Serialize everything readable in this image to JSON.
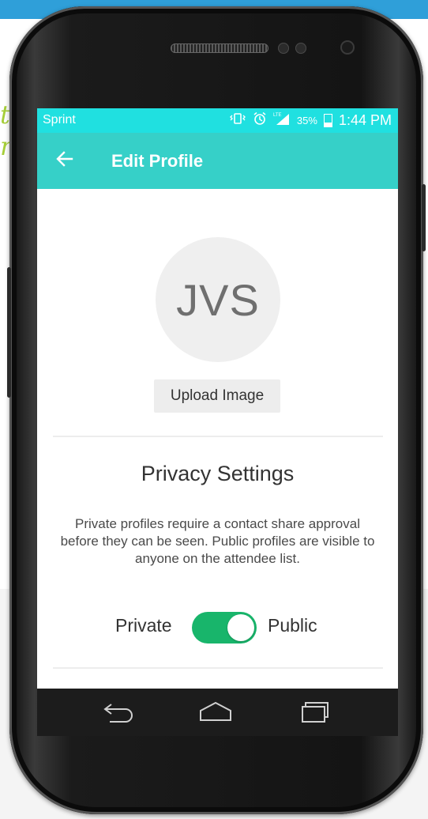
{
  "colors": {
    "status_bar": "#20e0e0",
    "app_bar": "#36d0c8",
    "toggle_on": "#18b56b",
    "top_strip": "#2f9fd9",
    "scribble": "#a6ce39"
  },
  "background_scribble": [
    "to",
    "nd"
  ],
  "status_bar": {
    "carrier": "Sprint",
    "battery_percent": "35%",
    "time": "1:44 PM",
    "icons": [
      "vibrate-icon",
      "alarm-icon",
      "lte-signal-icon",
      "battery-icon"
    ]
  },
  "app_bar": {
    "back_icon": "arrow-left-icon",
    "title": "Edit Profile"
  },
  "profile": {
    "initials": "JVS",
    "upload_label": "Upload Image"
  },
  "privacy": {
    "title": "Privacy Settings",
    "description": "Private profiles require a contact share approval before they can be seen. Public profiles are visible to anyone on the attendee list.",
    "toggle_left_label": "Private",
    "toggle_right_label": "Public",
    "toggle_state": "Public"
  },
  "nav_bar": {
    "buttons": [
      "back-icon",
      "home-icon",
      "recent-apps-icon"
    ]
  }
}
